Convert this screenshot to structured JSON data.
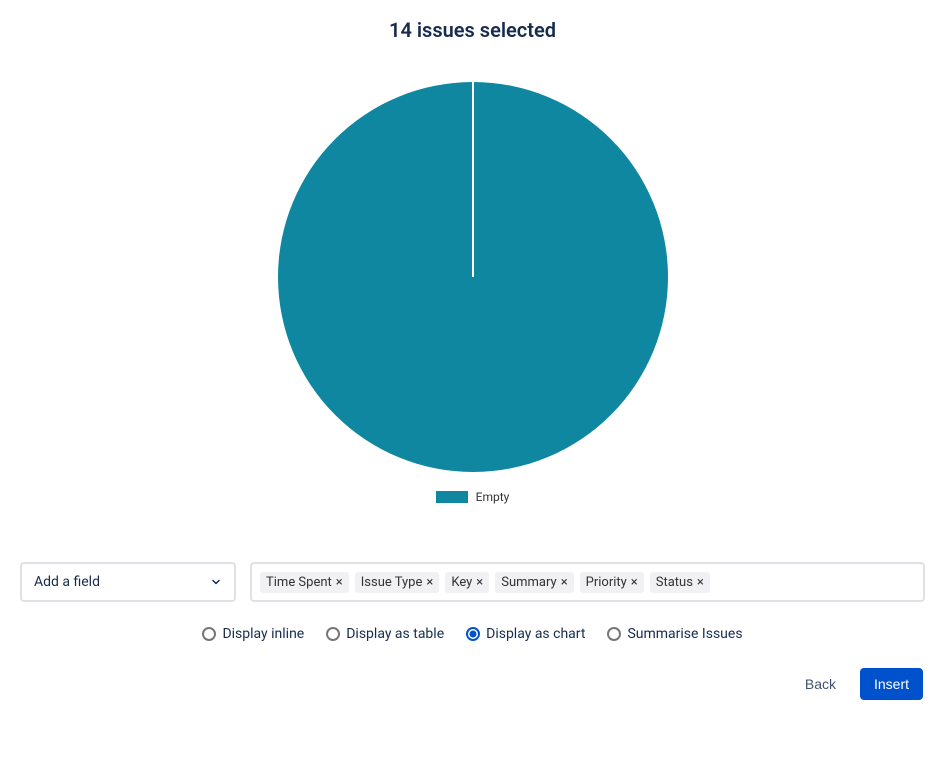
{
  "title": "14 issues selected",
  "colors": {
    "pie": "#0f87a1",
    "primary": "#0052CC"
  },
  "legend": {
    "label": "Empty"
  },
  "dropdown": {
    "placeholder": "Add a field"
  },
  "chips": [
    {
      "label": "Time Spent"
    },
    {
      "label": "Issue Type"
    },
    {
      "label": "Key"
    },
    {
      "label": "Summary"
    },
    {
      "label": "Priority"
    },
    {
      "label": "Status"
    }
  ],
  "display_options": [
    {
      "label": "Display inline",
      "selected": false
    },
    {
      "label": "Display as table",
      "selected": false
    },
    {
      "label": "Display as chart",
      "selected": true
    },
    {
      "label": "Summarise Issues",
      "selected": false
    }
  ],
  "buttons": {
    "back": "Back",
    "insert": "Insert"
  },
  "chart_data": {
    "type": "pie",
    "title": "14 issues selected",
    "series": [
      {
        "name": "Empty",
        "value": 14,
        "color": "#0f87a1"
      }
    ],
    "total": 14,
    "legend_position": "bottom"
  }
}
